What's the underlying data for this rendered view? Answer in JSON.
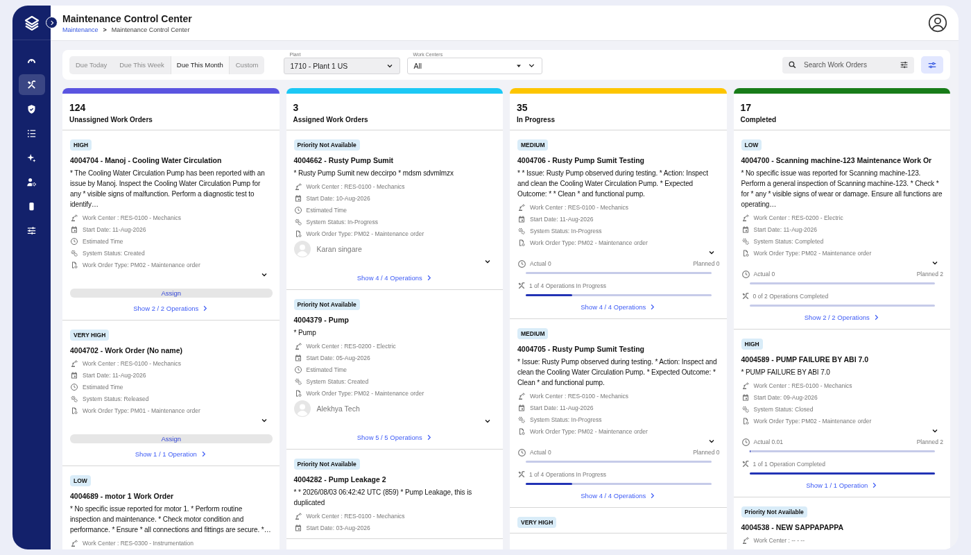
{
  "sidebar": {
    "items": [
      {
        "selected": false
      },
      {
        "selected": true
      },
      {
        "selected": false
      },
      {
        "selected": false
      },
      {
        "selected": false
      },
      {
        "selected": false
      },
      {
        "selected": false
      },
      {
        "selected": false
      }
    ]
  },
  "header": {
    "title": "Maintenance Control Center",
    "breadcrumb": [
      {
        "kind": "link",
        "text": "Maintenance"
      },
      {
        "kind": "current",
        "text": "Maintenance Control Center"
      }
    ],
    "breadcrumb_separator": ">"
  },
  "filters": {
    "due": [
      {
        "label": "Due Today",
        "selected": false
      },
      {
        "label": "Due This Week",
        "selected": false
      },
      {
        "label": "Due This Month",
        "selected": true
      },
      {
        "label": "Custom",
        "selected": false
      }
    ],
    "plant": {
      "label": "Plant",
      "value": "1710 - Plant 1 US"
    },
    "work_centers": {
      "label": "Work Centers",
      "value": "All"
    },
    "search": {
      "placeholder": "Search Work Orders"
    }
  },
  "columns": [
    {
      "count": "124",
      "title": "Unassigned Work Orders",
      "color": "#5a54e0",
      "cards": [
        {
          "priority": "HIGH",
          "title": "4004704 - Manoj - Cooling Water Circulation",
          "description": "* The Cooling Water Circulation Pump has been reported with an issue by Manoj. Inspect the Cooling Water Circulation Pump for any * visible signs of malfunction. Perform a diagnostic test to identify…",
          "meta": [
            {
              "kind": "work_center",
              "text": "Work Center : RES-0100 - Mechanics"
            },
            {
              "kind": "start_date",
              "text": "Start Date: 11-Aug-2026"
            },
            {
              "kind": "estimated_time",
              "text": "Estimated Time"
            },
            {
              "kind": "system_status",
              "text": "System Status: Created"
            },
            {
              "kind": "work_order_type",
              "text": "Work Order Type: PM02 - Maintenance order"
            }
          ],
          "assign": "Assign",
          "operations_link": "Show 2 / 2 Operations"
        },
        {
          "priority": "VERY HIGH",
          "title": "4004702 - Work Order (No name)",
          "meta": [
            {
              "kind": "work_center",
              "text": "Work Center : RES-0100 - Mechanics"
            },
            {
              "kind": "start_date",
              "text": "Start Date: 11-Aug-2026"
            },
            {
              "kind": "estimated_time",
              "text": "Estimated Time"
            },
            {
              "kind": "system_status",
              "text": "System Status: Released"
            },
            {
              "kind": "work_order_type",
              "text": "Work Order Type: PM01 - Maintenance order"
            }
          ],
          "assign": "Assign",
          "operations_link": "Show 1 / 1 Operation"
        },
        {
          "priority": "LOW",
          "title": "4004689 - motor 1 Work Order",
          "description": "* No specific issue reported for motor 1. * Perform routine inspection and maintenance. * Check motor condition and performance. * Ensure * all connections and fittings are secure. *…",
          "meta": [
            {
              "kind": "work_center",
              "text": "Work Center : RES-0300 - Instrumentation"
            }
          ]
        }
      ]
    },
    {
      "count": "3",
      "title": "Assigned Work Orders",
      "color": "#1cc8f5",
      "cards": [
        {
          "priority": "Priority Not Available",
          "title": "4004662 - Rusty Pump Sumit",
          "description": "* Rusty Pump Sumit new deccirpo * mdsm sdvmlmzx",
          "meta": [
            {
              "kind": "work_center",
              "text": "Work Center : RES-0100 - Mechanics"
            },
            {
              "kind": "start_date",
              "text": "Start Date: 10-Aug-2026"
            },
            {
              "kind": "estimated_time",
              "text": "Estimated Time"
            },
            {
              "kind": "system_status",
              "text": "System Status: In-Progress"
            },
            {
              "kind": "work_order_type",
              "text": "Work Order Type: PM02 - Maintenance order"
            }
          ],
          "assignee": "Karan singare",
          "operations_link": "Show 4 / 4 Operations"
        },
        {
          "priority": "Priority Not Available",
          "title": "4004379 - Pump",
          "description": "* Pump",
          "meta": [
            {
              "kind": "work_center",
              "text": "Work Center : RES-0200 - Electric"
            },
            {
              "kind": "start_date",
              "text": "Start Date: 05-Aug-2026"
            },
            {
              "kind": "estimated_time",
              "text": "Estimated Time"
            },
            {
              "kind": "system_status",
              "text": "System Status: Created"
            },
            {
              "kind": "work_order_type",
              "text": "Work Order Type: PM02 - Maintenance order"
            }
          ],
          "assignee": "Alekhya Tech",
          "operations_link": "Show 5 / 5 Operations"
        },
        {
          "priority": "Priority Not Available",
          "title": "4004282 - Pump Leakage 2",
          "description": "* * 2026/08/03 06:42:42 UTC (859) * Pump Leakage, this is duplicated",
          "meta": [
            {
              "kind": "work_center",
              "text": "Work Center : RES-0100 - Mechanics"
            },
            {
              "kind": "start_date",
              "text": "Start Date: 03-Aug-2026"
            }
          ]
        }
      ]
    },
    {
      "count": "35",
      "title": "In Progress",
      "color": "#fdc500",
      "cards": [
        {
          "priority": "MEDIUM",
          "title": "4004706 - Rusty Pump Sumit Testing",
          "description": "* * Issue: Rusty Pump observed during testing. * Action: Inspect and clean the Cooling Water Circulation Pump. * Expected Outcome: * * Clean * and functional pump.",
          "meta": [
            {
              "kind": "work_center",
              "text": "Work Center : RES-0100 - Mechanics"
            },
            {
              "kind": "start_date",
              "text": "Start Date: 11-Aug-2026"
            },
            {
              "kind": "system_status",
              "text": "System Status: In-Progress"
            },
            {
              "kind": "work_order_type",
              "text": "Work Order Type: PM02 - Maintenance order"
            }
          ],
          "progress": {
            "actual": "Actual 0",
            "planned": "Planned 0",
            "time": {
              "level": 0
            },
            "operations": {
              "text": "1 of 4 Operations In Progress",
              "level": 0.25
            }
          },
          "operations_link": "Show 4 / 4 Operations"
        },
        {
          "priority": "MEDIUM",
          "title": "4004705 - Rusty Pump Sumit Testing",
          "description": "* Issue: Rusty Pump observed during testing. * Action: Inspect and clean the Cooling Water Circulation Pump. * Expected Outcome: * Clean * and functional pump.",
          "meta": [
            {
              "kind": "work_center",
              "text": "Work Center : RES-0100 - Mechanics"
            },
            {
              "kind": "start_date",
              "text": "Start Date: 11-Aug-2026"
            },
            {
              "kind": "system_status",
              "text": "System Status: In-Progress"
            },
            {
              "kind": "work_order_type",
              "text": "Work Order Type: PM02 - Maintenance order"
            }
          ],
          "progress": {
            "actual": "Actual 0",
            "planned": "Planned 0",
            "time": {
              "level": 0
            },
            "operations": {
              "text": "1 of 4 Operations In Progress",
              "level": 0.25
            }
          },
          "operations_link": "Show 4 / 4 Operations"
        },
        {
          "priority": "VERY HIGH"
        }
      ]
    },
    {
      "count": "17",
      "title": "Completed",
      "color": "#187c19",
      "cards": [
        {
          "priority": "LOW",
          "title": "4004700 - Scanning machine-123 Maintenance Work Or",
          "description": "* No specific issue was reported for Scanning machine-123. Perform a general inspection of Scanning machine-123. * Check * for * any * visible signs of wear or damage. Ensure all functions are operating…",
          "meta": [
            {
              "kind": "work_center",
              "text": "Work Center : RES-0200 - Electric"
            },
            {
              "kind": "start_date",
              "text": "Start Date: 11-Aug-2026"
            },
            {
              "kind": "system_status",
              "text": "System Status: Completed"
            },
            {
              "kind": "work_order_type",
              "text": "Work Order Type: PM02 - Maintenance order"
            }
          ],
          "progress": {
            "actual": "Actual 0",
            "planned": "Planned 2",
            "time": {
              "level": 0
            },
            "operations": {
              "text": "0 of 2 Operations Completed",
              "level": 0
            }
          },
          "operations_link": "Show 2 / 2 Operations"
        },
        {
          "priority": "HIGH",
          "title": "4004589 - PUMP FAILURE BY ABI 7.0",
          "description": "* PUMP FAILURE BY ABI 7.0",
          "meta": [
            {
              "kind": "work_center",
              "text": "Work Center : RES-0100 - Mechanics"
            },
            {
              "kind": "start_date",
              "text": "Start Date: 09-Aug-2026"
            },
            {
              "kind": "system_status",
              "text": "System Status: Closed"
            },
            {
              "kind": "work_order_type",
              "text": "Work Order Type: PM02 - Maintenance order"
            }
          ],
          "progress": {
            "actual": "Actual 0.01",
            "planned": "Planned 2",
            "time": {
              "level": 0.005
            },
            "operations": {
              "text": "1 of 1 Operation Completed",
              "level": 1
            }
          },
          "operations_link": "Show 1 / 1 Operation"
        },
        {
          "priority": "Priority Not Available",
          "title": "4004538 - NEW SAPPAPAPPA",
          "meta": [
            {
              "kind": "work_center",
              "text": "Work Center : -- - --"
            }
          ]
        }
      ]
    }
  ]
}
